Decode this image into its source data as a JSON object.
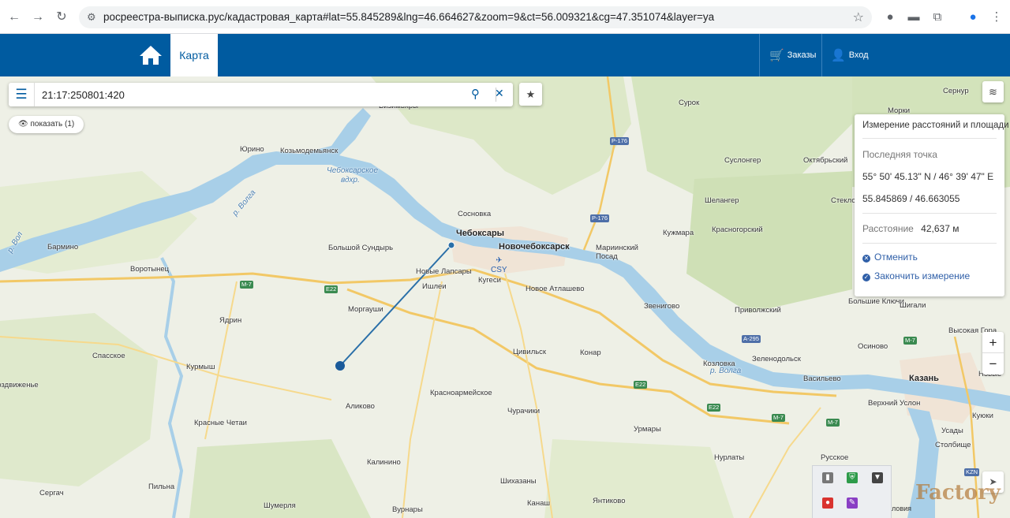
{
  "browser": {
    "url": "росреестра-выписка.рус/кадастровая_карта#lat=55.845289&lng=46.664627&zoom=9&ct=56.009321&cg=47.351074&layer=ya"
  },
  "header": {
    "tab_map": "Карта",
    "orders_label": "Заказы",
    "login_label": "Вход"
  },
  "search": {
    "value": "21:17:250801:420"
  },
  "show_button": "показать (1)",
  "measure_panel": {
    "title": "Измерение расстояний и площади",
    "last_point_label": "Последняя точка",
    "coords_dms": "55° 50' 45.13\" N / 46° 39' 47\" E",
    "coords_dec": "55.845869 / 46.663055",
    "distance_label": "Расстояние",
    "distance_value": "42,637 м",
    "cancel_label": "Отменить",
    "finish_label": "Закончить измерение"
  },
  "map": {
    "places": [
      {
        "name": "Визимьяры",
        "kind": "normal"
      },
      {
        "name": "Козьмодемьянск",
        "kind": "normal"
      },
      {
        "name": "Юрино",
        "kind": "normal"
      },
      {
        "name": "Чебоксарское",
        "kind": "water"
      },
      {
        "name": "вдхр.",
        "kind": "water"
      },
      {
        "name": "Сосновка",
        "kind": "normal"
      },
      {
        "name": "Чебоксары",
        "kind": "big"
      },
      {
        "name": "Новочебоксарск",
        "kind": "big"
      },
      {
        "name": "Большой Сундырь",
        "kind": "normal"
      },
      {
        "name": "Новые Лапсары",
        "kind": "normal"
      },
      {
        "name": "Кугеси",
        "kind": "normal"
      },
      {
        "name": "Ишлеи",
        "kind": "normal"
      },
      {
        "name": "Новое Атлашево",
        "kind": "normal"
      },
      {
        "name": "Моргауши",
        "kind": "normal"
      },
      {
        "name": "Бармино",
        "kind": "normal"
      },
      {
        "name": "Воротынец",
        "kind": "normal"
      },
      {
        "name": "Ядрин",
        "kind": "normal"
      },
      {
        "name": "Спасское",
        "kind": "normal"
      },
      {
        "name": "Курмыш",
        "kind": "normal"
      },
      {
        "name": "Воздвиженье",
        "kind": "normal"
      },
      {
        "name": "Красные Четаи",
        "kind": "normal"
      },
      {
        "name": "Аликово",
        "kind": "normal"
      },
      {
        "name": "Красноармейское",
        "kind": "normal"
      },
      {
        "name": "Цивильск",
        "kind": "normal"
      },
      {
        "name": "Конар",
        "kind": "normal"
      },
      {
        "name": "Чурачики",
        "kind": "normal"
      },
      {
        "name": "Урмары",
        "kind": "normal"
      },
      {
        "name": "Калинино",
        "kind": "normal"
      },
      {
        "name": "Сергач",
        "kind": "normal"
      },
      {
        "name": "Пильна",
        "kind": "normal"
      },
      {
        "name": "Шумерля",
        "kind": "normal"
      },
      {
        "name": "Вурнары",
        "kind": "normal"
      },
      {
        "name": "Шихазаны",
        "kind": "normal"
      },
      {
        "name": "Канаш",
        "kind": "normal"
      },
      {
        "name": "Янтиково",
        "kind": "normal"
      },
      {
        "name": "Нурлаты",
        "kind": "normal"
      },
      {
        "name": "Русское",
        "kind": "normal"
      },
      {
        "name": "Сурок",
        "kind": "normal"
      },
      {
        "name": "Морки",
        "kind": "normal"
      },
      {
        "name": "Суслонгер",
        "kind": "normal"
      },
      {
        "name": "Октябрьский",
        "kind": "normal"
      },
      {
        "name": "Шелангер",
        "kind": "normal"
      },
      {
        "name": "Кужмара",
        "kind": "normal"
      },
      {
        "name": "Красногорский",
        "kind": "normal"
      },
      {
        "name": "Мариинский",
        "kind": "normal"
      },
      {
        "name": "Посад",
        "kind": "normal"
      },
      {
        "name": "Звенигово",
        "kind": "normal"
      },
      {
        "name": "Приволжский",
        "kind": "normal"
      },
      {
        "name": "Большие Ключи",
        "kind": "normal"
      },
      {
        "name": "Шигали",
        "kind": "normal"
      },
      {
        "name": "Козловка",
        "kind": "normal"
      },
      {
        "name": "Зеленодольск",
        "kind": "normal"
      },
      {
        "name": "Осиново",
        "kind": "normal"
      },
      {
        "name": "Высокая Гора",
        "kind": "normal"
      },
      {
        "name": "Новые",
        "kind": "normal"
      },
      {
        "name": "Васильево",
        "kind": "normal"
      },
      {
        "name": "Казань",
        "kind": "big"
      },
      {
        "name": "Верхний Услон",
        "kind": "normal"
      },
      {
        "name": "Куюки",
        "kind": "normal"
      },
      {
        "name": "Усады",
        "kind": "normal"
      },
      {
        "name": "Столбище",
        "kind": "normal"
      },
      {
        "name": "Сернур",
        "kind": "normal"
      },
      {
        "name": "Стекло",
        "kind": "normal"
      },
      {
        "name": "р. Волга",
        "kind": "water"
      },
      {
        "name": "р. Волга",
        "kind": "water"
      },
      {
        "name": "р. Вол",
        "kind": "water"
      }
    ],
    "roads": [
      {
        "label": "Р-176",
        "kind": "blue"
      },
      {
        "label": "Р-176",
        "kind": "blue"
      },
      {
        "label": "М-7",
        "kind": "green"
      },
      {
        "label": "E22",
        "kind": "green"
      },
      {
        "label": "E22",
        "kind": "green"
      },
      {
        "label": "E22",
        "kind": "green"
      },
      {
        "label": "A-295",
        "kind": "blue"
      },
      {
        "label": "М-7",
        "kind": "green"
      },
      {
        "label": "М-7",
        "kind": "green"
      },
      {
        "label": "М-7",
        "kind": "green"
      }
    ],
    "airport_code": "CSY",
    "airport_kazan": "KZN"
  },
  "watermark": "Factory",
  "copyright": "ловия"
}
